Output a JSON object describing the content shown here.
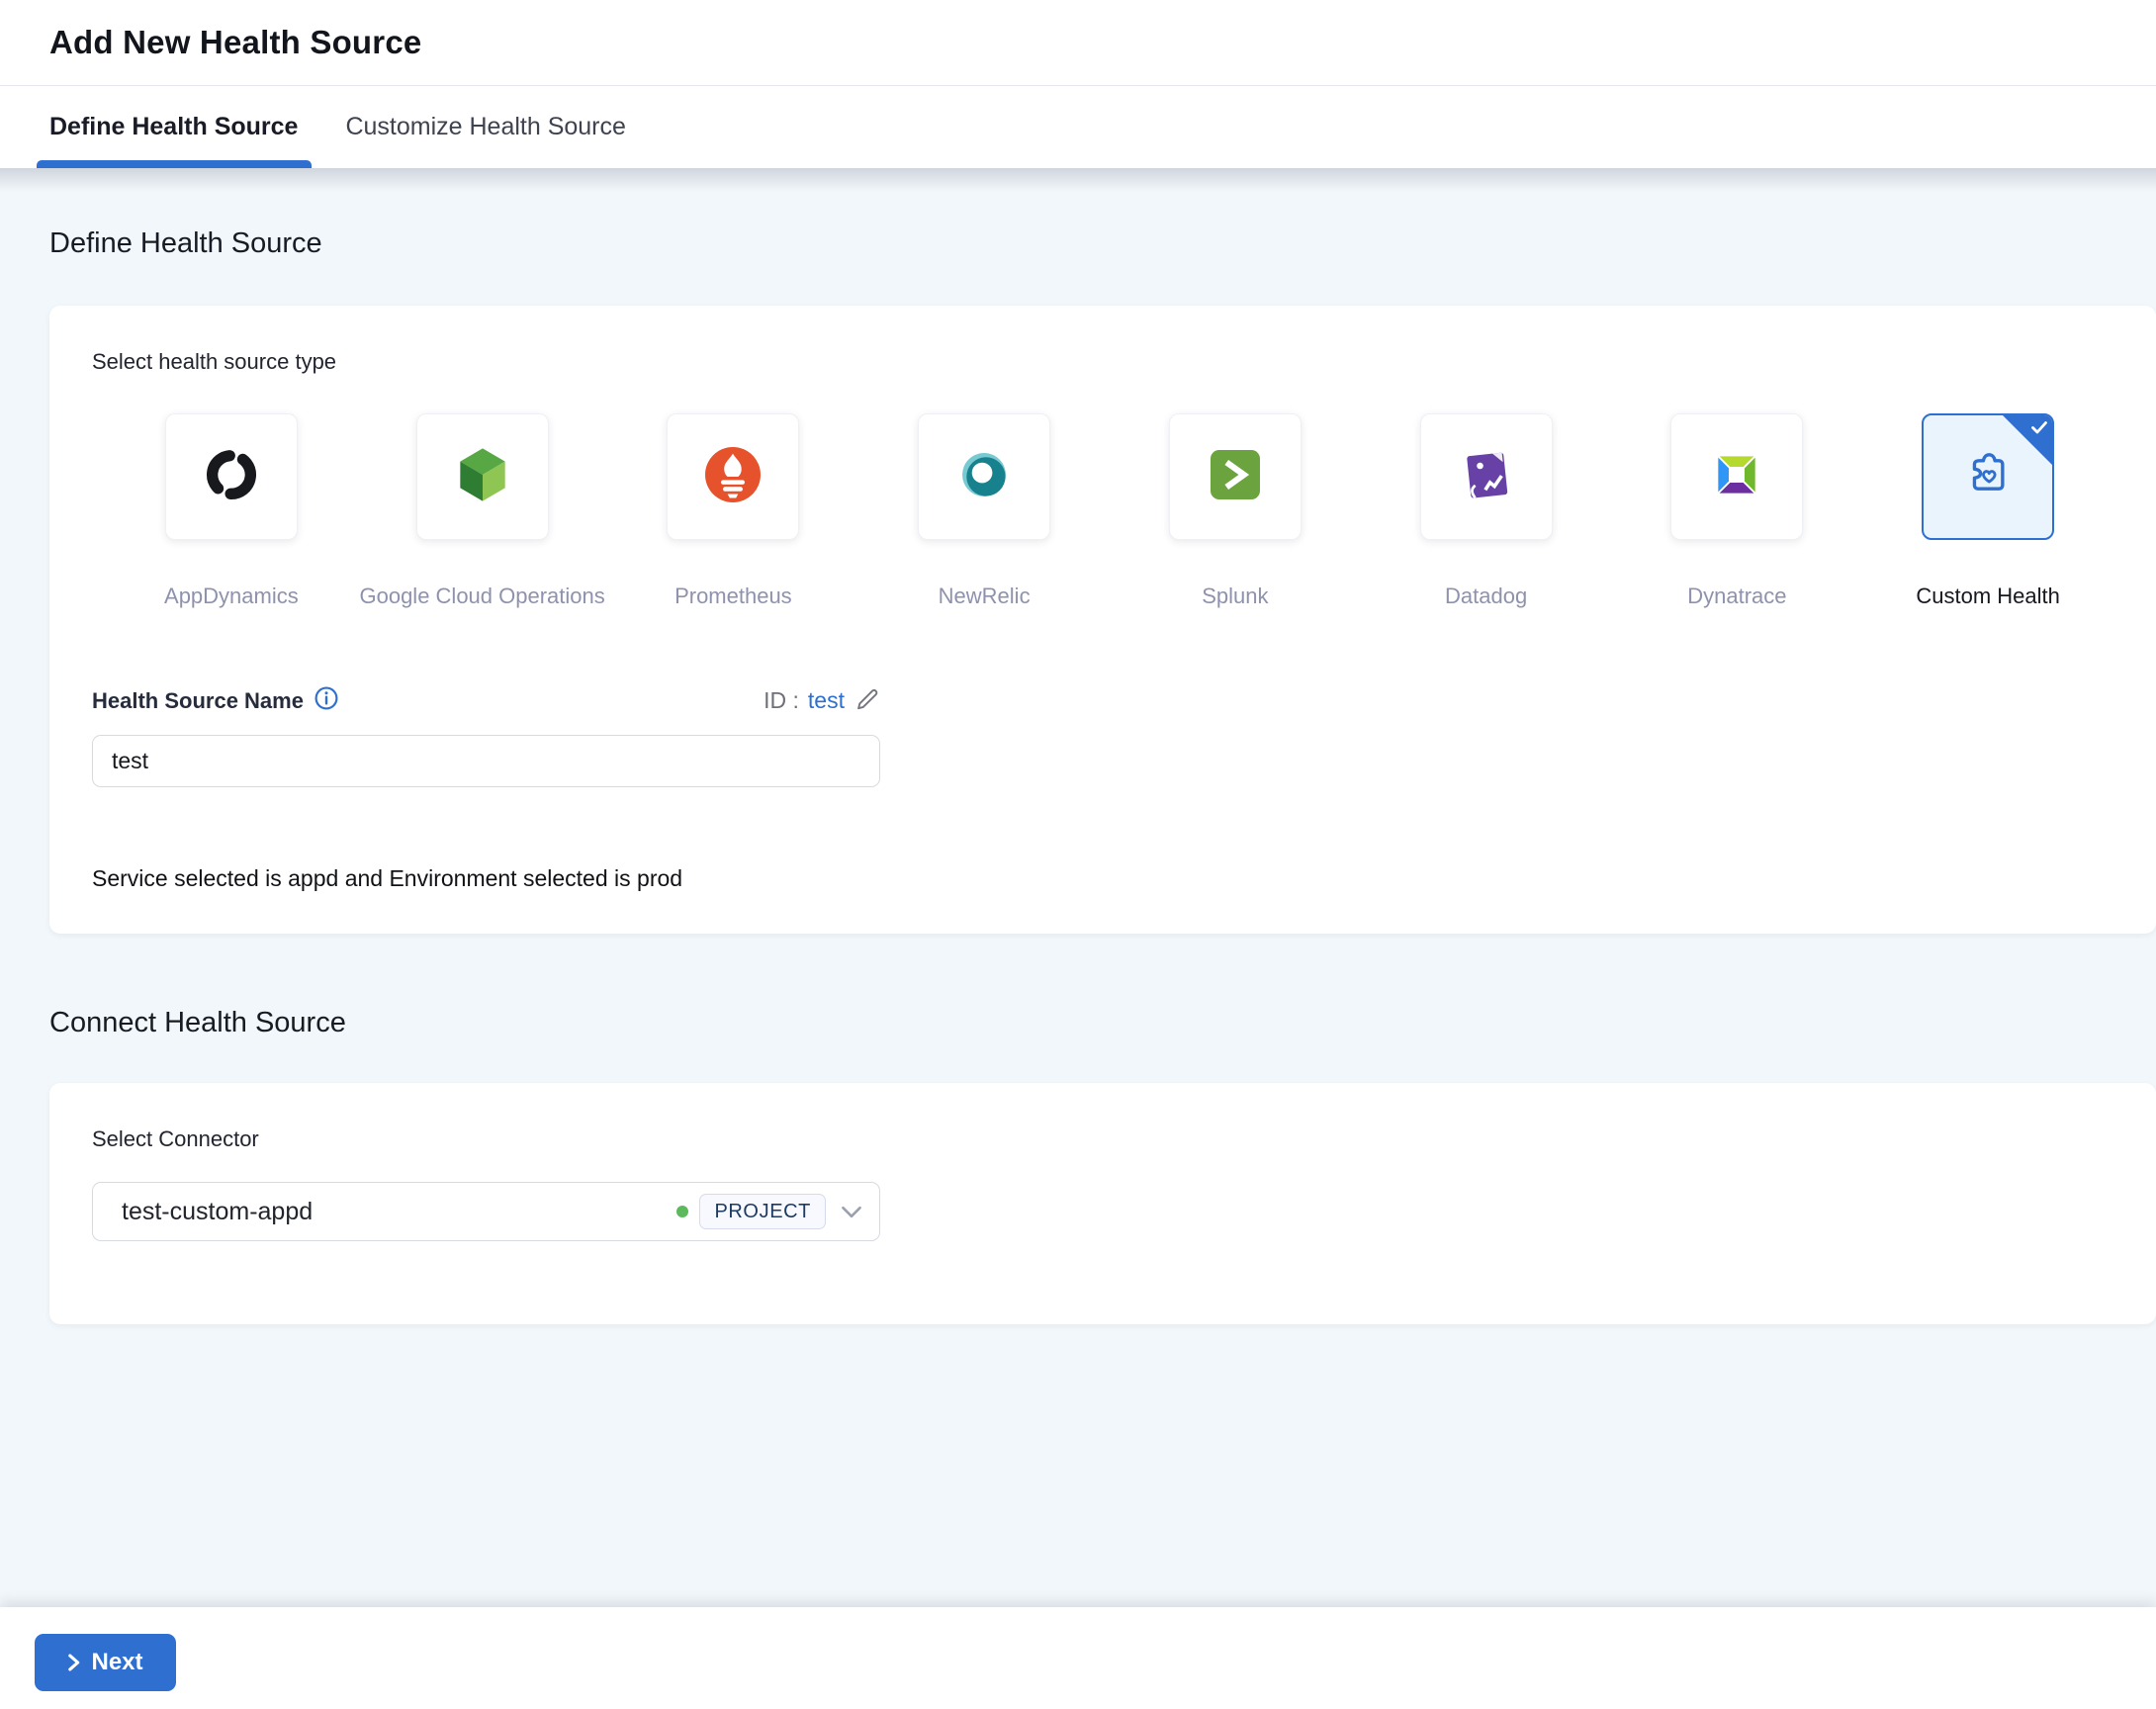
{
  "header": {
    "title": "Add New Health Source"
  },
  "tabs": [
    {
      "label": "Define Health Source",
      "active": true
    },
    {
      "label": "Customize Health Source",
      "active": false
    }
  ],
  "define_section": {
    "heading": "Define Health Source",
    "select_type_label": "Select health source type",
    "source_types": [
      {
        "label": "AppDynamics",
        "selected": false
      },
      {
        "label": "Google Cloud Operations",
        "selected": false
      },
      {
        "label": "Prometheus",
        "selected": false
      },
      {
        "label": "NewRelic",
        "selected": false
      },
      {
        "label": "Splunk",
        "selected": false
      },
      {
        "label": "Datadog",
        "selected": false
      },
      {
        "label": "Dynatrace",
        "selected": false
      },
      {
        "label": "Custom Health",
        "selected": true
      }
    ],
    "name_label": "Health Source Name",
    "id_prefix": "ID :",
    "id_value": "test",
    "name_value": "test",
    "service_env_note": "Service selected is appd and Environment selected is prod"
  },
  "connect_section": {
    "heading": "Connect Health Source",
    "connector_label": "Select Connector",
    "connector_value": "test-custom-appd",
    "connector_scope": "PROJECT",
    "connector_status_color": "#5cba5c"
  },
  "footer": {
    "next_label": "Next"
  },
  "colors": {
    "accent_blue": "#2e6fd0",
    "content_background": "#f1f7fa",
    "selected_tile_background": "#e9f4fc",
    "tile_label_gray": "#8f92ad",
    "prometheus_orange": "#e6522c",
    "splunk_green": "#6ba43e",
    "datadog_purple": "#6741a5",
    "newrelic_teal": "#17828e"
  }
}
